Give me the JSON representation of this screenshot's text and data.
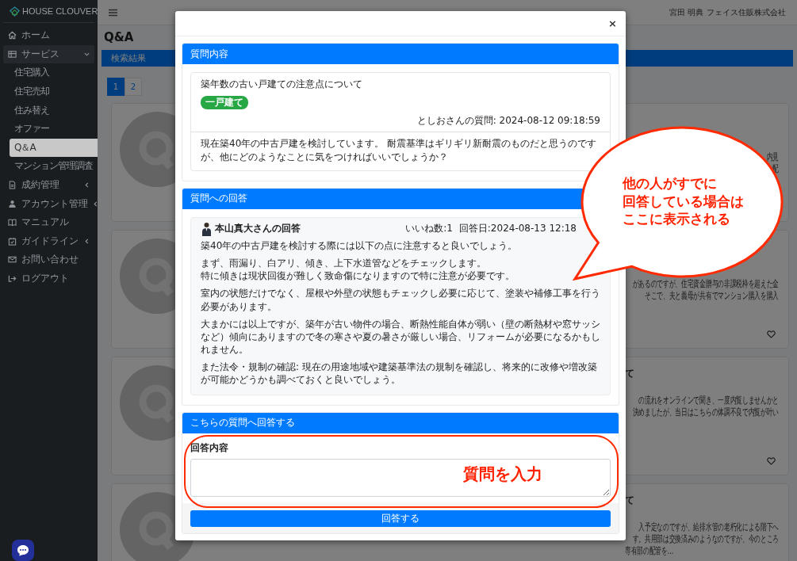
{
  "sidebar": {
    "logo": "HOUSE CLOUVER",
    "items": [
      {
        "label": "ホーム",
        "kind": "link",
        "selected": false
      },
      {
        "label": "サービス",
        "kind": "group",
        "selected": false,
        "expanded": true,
        "children": [
          {
            "label": "住宅購入",
            "selected": false
          },
          {
            "label": "住宅売却",
            "selected": false
          },
          {
            "label": "住み替え",
            "selected": false
          },
          {
            "label": "オファー",
            "selected": false
          },
          {
            "label": "Q＆A",
            "selected": true
          },
          {
            "label": "マンション管理調査",
            "selected": false
          }
        ]
      },
      {
        "label": "成約管理",
        "kind": "group",
        "selected": false,
        "expanded": false
      },
      {
        "label": "アカウント管理",
        "kind": "group",
        "selected": false,
        "expanded": false
      },
      {
        "label": "マニュアル",
        "kind": "link",
        "selected": false
      },
      {
        "label": "ガイドライン",
        "kind": "group",
        "selected": false,
        "expanded": false
      },
      {
        "label": "お問い合わせ",
        "kind": "link",
        "selected": false
      },
      {
        "label": "ログアウト",
        "kind": "link",
        "selected": false
      }
    ]
  },
  "top_bar": {
    "user_name": "宮田 明典",
    "company": "フェイス住販株式会社"
  },
  "page": {
    "title": "Q&A",
    "results_header": "検索結果",
    "pagination": [
      {
        "label": "1",
        "selected": true
      },
      {
        "label": "2",
        "selected": false
      }
    ],
    "cards": [
      {
        "lines": [
          {
            "text": "内見",
            "kind": "clipped"
          },
          {
            "text": "配",
            "kind": "clipped"
          }
        ],
        "like_icon": false
      },
      {
        "lines": [
          {
            "text": "があるのですが、住宅資金贈与の非課税枠を超えた金",
            "kind": "clipped"
          },
          {
            "text": "そこで、夫と義母が共有でマンション購入を購入",
            "kind": "clipped"
          }
        ],
        "like_icon": true
      },
      {
        "title": "て",
        "lines": [
          {
            "text": "の流れをオンラインで聞き、一度内覧しませんかと",
            "kind": "clipped"
          },
          {
            "text": "決めましたが、当日はこちらの体調不良で内覧が叶い",
            "kind": "clipped"
          }
        ],
        "like_icon": true
      },
      {
        "title": "て",
        "lines": [
          {
            "text": "入予定なのですが、給排水管の老朽化による階下へ",
            "kind": "clipped"
          },
          {
            "text": "す。共用部は交換済みのようなのですが、今のところ",
            "kind": "clipped"
          },
          {
            "text": "専有部の配管を...",
            "kind": "full"
          }
        ],
        "like_icon": false
      }
    ]
  },
  "modal": {
    "close": "×",
    "question": {
      "header": "質問内容",
      "title": "築年数の古い戸建ての注意点について",
      "tag": "一戸建て",
      "meta": "としおさんの質問: 2024-08-12 09:18:59",
      "body": "現在築40年の中古戸建を検討しています。 耐震基準はギリギリ新耐震のものだと思うのですが、他にどのようなことに気をつければいいでしょうか？"
    },
    "answers": {
      "header": "質問への回答",
      "items": [
        {
          "author": "本山真大さんの回答",
          "likes": "いいね数:1",
          "date": "回答日:2024-08-13 12:18",
          "paragraphs": [
            [
              "築40年の中古戸建を検討する際には以下の点に注意すると良いでしょう。"
            ],
            [
              "まず、雨漏り、白アリ、傾き、上下水道管などをチェックします。",
              "特に傾きは現状回復が難しく致命傷になりますので特に注意が必要です。"
            ],
            [
              "室内の状態だけでなく、屋根や外壁の状態もチェックし必要に応じて、塗装や補修工事を行う必要があります。"
            ],
            [
              "大まかには以上ですが、築年が古い物件の場合、断熱性能自体が弱い（壁の断熱材や窓サッシなど）傾向にありますので冬の寒さや夏の暑さが厳しい場合、リフォームが必要になるかもしれません。"
            ],
            [
              "また法令・規制の確認: 現在の用途地域や建築基準法の規制を確認し、将来的に改修や増改築が可能かどうかも調べておくと良いでしょう。"
            ]
          ]
        }
      ]
    },
    "reply": {
      "header": "こちらの質問へ回答する",
      "label": "回答内容",
      "button": "回答する"
    }
  },
  "annotations": [
    {
      "kind": "callout",
      "lines": [
        "他の人がすでに",
        "回答している場合は",
        "ここに表示される"
      ]
    },
    {
      "kind": "highlight",
      "text": "質問を入力"
    }
  ]
}
